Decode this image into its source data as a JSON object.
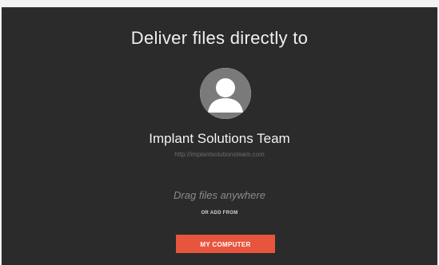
{
  "dialog": {
    "title": "Deliver files directly to",
    "recipient": {
      "name": "Implant Solutions Team",
      "url": "http://implantsolutionsteam.com",
      "avatar_icon": "user-silhouette-icon"
    },
    "drop_hint": "Drag files anywhere",
    "alt_hint": "OR ADD FROM",
    "button_label": "MY COMPUTER"
  },
  "colors": {
    "panel_bg": "#2b2b2b",
    "accent": "#e8553d",
    "avatar_bg": "#ffffff",
    "avatar_figure": "#7a7a7a"
  }
}
